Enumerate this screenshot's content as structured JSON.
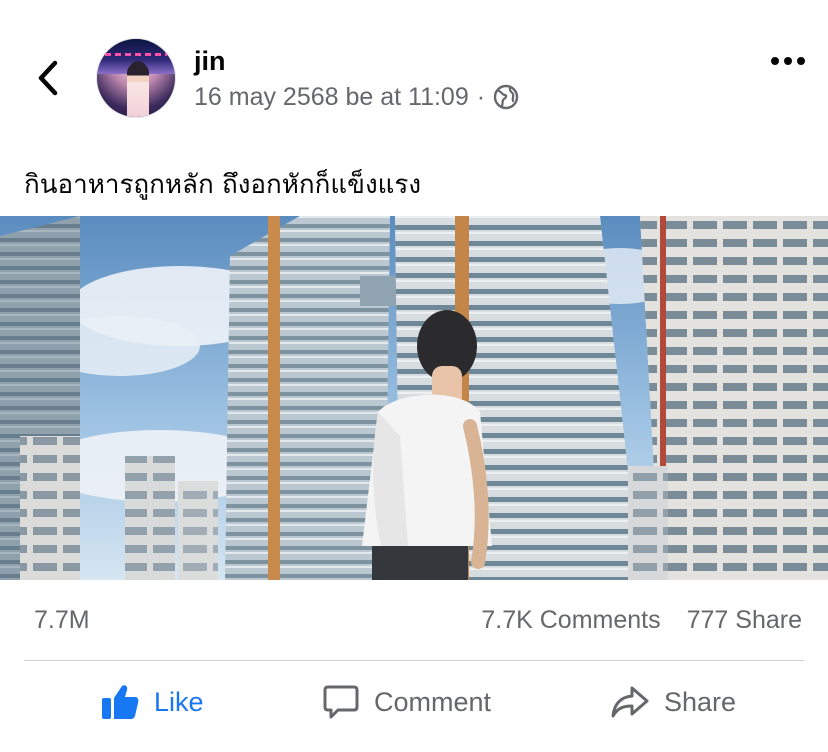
{
  "post": {
    "author_name": "jin",
    "timestamp": "16 may 2568 be at 11:09",
    "separator": "·",
    "privacy_icon": "globe-icon",
    "caption": "กินอาหารถูกหลัก ถึงอกหักก็แข็งแรง"
  },
  "header": {
    "back_icon": "chevron-left-icon",
    "more_icon": "more-horizontal-icon"
  },
  "stats": {
    "reactions": "7.7M",
    "comments": "7.7K Comments",
    "shares": "777 Share"
  },
  "actions": {
    "like_label": "Like",
    "comment_label": "Comment",
    "share_label": "Share"
  },
  "colors": {
    "accent": "#1877f2",
    "secondary_text": "#65676b",
    "divider": "#ced0d4"
  }
}
